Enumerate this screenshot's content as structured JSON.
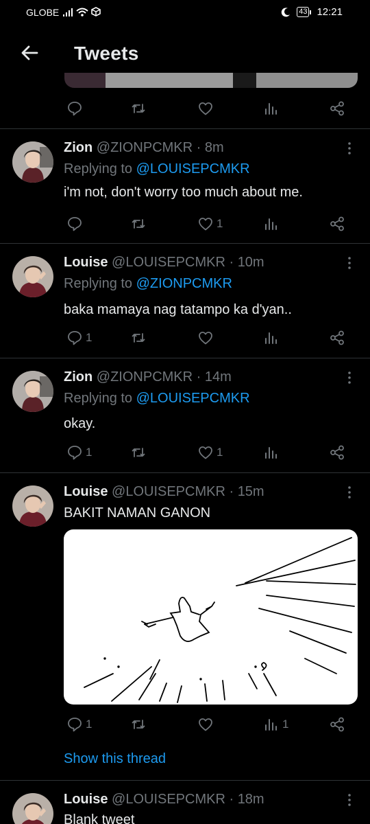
{
  "status_bar": {
    "carrier": "GLOBE",
    "battery": "43",
    "time": "12:21"
  },
  "header": {
    "title": "Tweets"
  },
  "tweets": [
    {
      "name": "Zion",
      "handle": "@ZIONPCMKR",
      "time": "8m",
      "replying_prefix": "Replying to",
      "replying_to": "@LOUISEPCMKR",
      "text": "i'm not, don't worry too much about me.",
      "reply_count": "",
      "like_count": "1",
      "view_count": ""
    },
    {
      "name": "Louise",
      "handle": "@LOUISEPCMKR",
      "time": "10m",
      "replying_prefix": "Replying to",
      "replying_to": "@ZIONPCMKR",
      "text": "baka mamaya nag tatampo ka d'yan..",
      "reply_count": "1",
      "like_count": "",
      "view_count": ""
    },
    {
      "name": "Zion",
      "handle": "@ZIONPCMKR",
      "time": "14m",
      "replying_prefix": "Replying to",
      "replying_to": "@LOUISEPCMKR",
      "text": "okay.",
      "reply_count": "1",
      "like_count": "1",
      "view_count": ""
    },
    {
      "name": "Louise",
      "handle": "@LOUISEPCMKR",
      "time": "15m",
      "text": "BAKIT NAMAN GANON",
      "reply_count": "1",
      "like_count": "",
      "view_count": "1",
      "show_thread": "Show this thread"
    },
    {
      "name": "Louise",
      "handle": "@LOUISEPCMKR",
      "time": "18m",
      "text": "Blank tweet"
    }
  ],
  "colors": {
    "background": "#000000",
    "text": "#e7e9ea",
    "secondary": "#71767b",
    "accent": "#1d9bf0",
    "divider": "#2f3336"
  },
  "icons": [
    "back-arrow-icon",
    "reply-icon",
    "retweet-icon",
    "like-icon",
    "views-icon",
    "share-icon",
    "more-icon"
  ]
}
